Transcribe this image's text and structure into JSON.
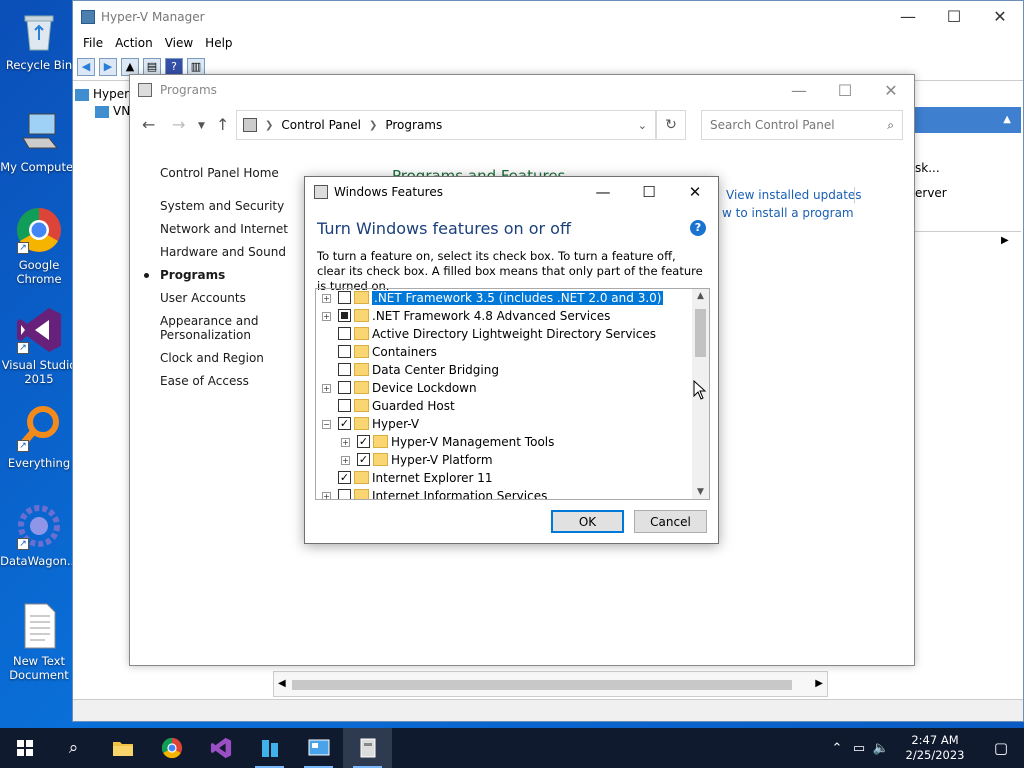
{
  "desktop": {
    "icons": [
      {
        "name": "Recycle Bin"
      },
      {
        "name": "My Computer"
      },
      {
        "name": "Google\nChrome"
      },
      {
        "name": "Visual Studio\n2015"
      },
      {
        "name": "Everything"
      },
      {
        "name": "DataWagon..."
      },
      {
        "name": "New Text\nDocument"
      }
    ]
  },
  "hyperv": {
    "title": "Hyper-V Manager",
    "menu": [
      "File",
      "Action",
      "View",
      "Help"
    ],
    "tree_root": "Hyper",
    "tree_child": "VN",
    "right_items": [
      "sk...",
      "erver"
    ]
  },
  "programs": {
    "title": "Programs",
    "breadcrumb": [
      "Control Panel",
      "Programs"
    ],
    "search_placeholder": "Search Control Panel",
    "sidebar": {
      "home": "Control Panel Home",
      "items": [
        "System and Security",
        "Network and Internet",
        "Hardware and Sound",
        "Programs",
        "User Accounts",
        "Appearance and\nPersonalization",
        "Clock and Region",
        "Ease of Access"
      ],
      "active_index": 3
    },
    "section_title": "Programs and Features",
    "links": [
      "View installed updates",
      "w to install a program"
    ]
  },
  "features": {
    "title": "Windows Features",
    "heading": "Turn Windows features on or off",
    "description": "To turn a feature on, select its check box. To turn a feature off, clear its check box. A filled box means that only part of the feature is turned on.",
    "items": [
      {
        "label": ".NET Framework 3.5 (includes .NET 2.0 and 3.0)",
        "state": "unchecked",
        "expander": "+",
        "level": 0,
        "selected": true
      },
      {
        "label": ".NET Framework 4.8 Advanced Services",
        "state": "partial",
        "expander": "+",
        "level": 0
      },
      {
        "label": "Active Directory Lightweight Directory Services",
        "state": "unchecked",
        "expander": "",
        "level": 0
      },
      {
        "label": "Containers",
        "state": "unchecked",
        "expander": "",
        "level": 0
      },
      {
        "label": "Data Center Bridging",
        "state": "unchecked",
        "expander": "",
        "level": 0
      },
      {
        "label": "Device Lockdown",
        "state": "unchecked",
        "expander": "+",
        "level": 0
      },
      {
        "label": "Guarded Host",
        "state": "unchecked",
        "expander": "",
        "level": 0
      },
      {
        "label": "Hyper-V",
        "state": "checked",
        "expander": "-",
        "level": 0
      },
      {
        "label": "Hyper-V Management Tools",
        "state": "checked",
        "expander": "+",
        "level": 1
      },
      {
        "label": "Hyper-V Platform",
        "state": "checked",
        "expander": "+",
        "level": 1
      },
      {
        "label": "Internet Explorer 11",
        "state": "checked",
        "expander": "",
        "level": 0
      },
      {
        "label": "Internet Information Services",
        "state": "unchecked",
        "expander": "+",
        "level": 0
      }
    ],
    "ok_label": "OK",
    "cancel_label": "Cancel"
  },
  "taskbar": {
    "time": "2:47 AM",
    "date": "2/25/2023"
  },
  "colors": {
    "desktop": "#0a63c9",
    "selection": "#0078d7",
    "link": "#1a5fb4",
    "heading": "#1a3f7a",
    "taskbar": "#0f1a2e"
  }
}
